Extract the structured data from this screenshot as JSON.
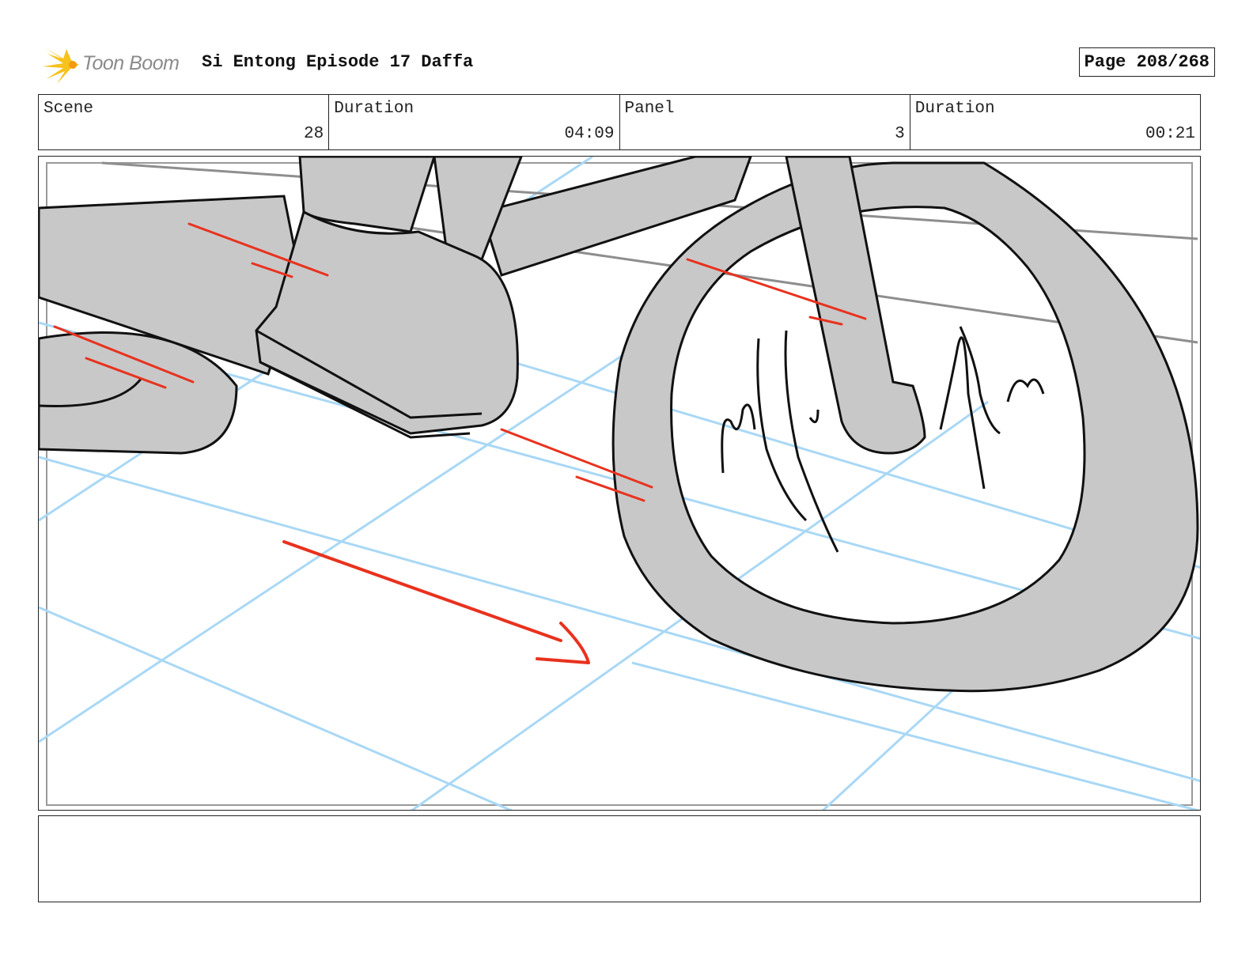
{
  "header": {
    "logo_text": "Toon Boom",
    "title": "Si Entong Episode 17 Daffa",
    "page": "Page 208/268"
  },
  "info": {
    "scene_label": "Scene",
    "scene_value": "28",
    "scene_duration_label": "Duration",
    "scene_duration_value": "04:09",
    "panel_label": "Panel",
    "panel_value": "3",
    "panel_duration_label": "Duration",
    "panel_duration_value": "00:21"
  },
  "colors": {
    "sketch_fill": "#c8c8c8",
    "guide_lines": "#a9d8f5",
    "motion_lines": "#e8321e",
    "logo_yellow": "#f6c21c"
  },
  "notes": {
    "text": ""
  }
}
